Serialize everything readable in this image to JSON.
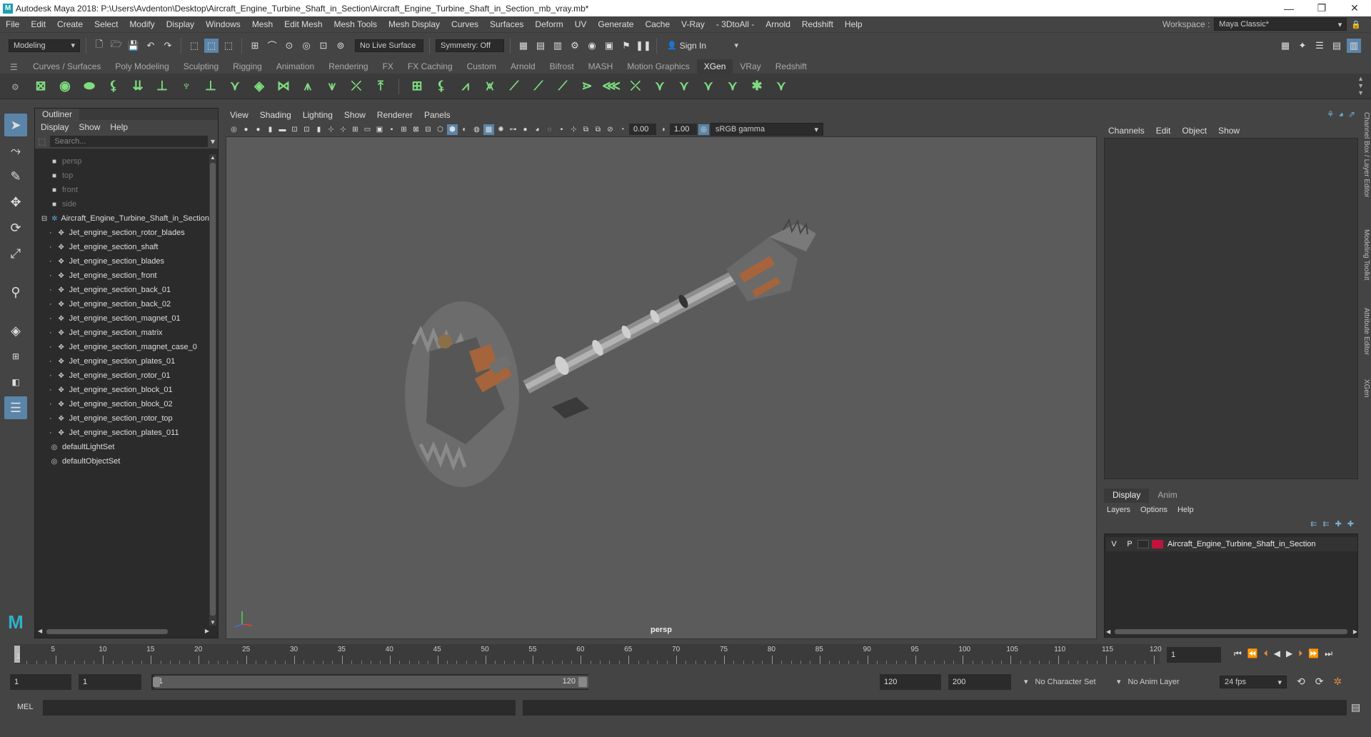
{
  "window": {
    "title": "Autodesk Maya 2018: P:\\Users\\Avdenton\\Desktop\\Aircraft_Engine_Turbine_Shaft_in_Section\\Aircraft_Engine_Turbine_Shaft_in_Section_mb_vray.mb*",
    "minimize": "—",
    "maximize": "❐",
    "close": "✕"
  },
  "menubar": {
    "items": [
      "File",
      "Edit",
      "Create",
      "Select",
      "Modify",
      "Display",
      "Windows",
      "Mesh",
      "Edit Mesh",
      "Mesh Tools",
      "Mesh Display",
      "Curves",
      "Surfaces",
      "Deform",
      "UV",
      "Generate",
      "Cache",
      "V-Ray",
      "- 3DtoAll -",
      "Arnold",
      "Redshift",
      "Help"
    ],
    "workspace_label": "Workspace :",
    "workspace_value": "Maya Classic*"
  },
  "statusline": {
    "mode": "Modeling",
    "live_surface": "No Live Surface",
    "symmetry": "Symmetry: Off",
    "sign_in": "Sign In"
  },
  "shelf": {
    "tabs": [
      "Curves / Surfaces",
      "Poly Modeling",
      "Sculpting",
      "Rigging",
      "Animation",
      "Rendering",
      "FX",
      "FX Caching",
      "Custom",
      "Arnold",
      "Bifrost",
      "MASH",
      "Motion Graphics",
      "XGen",
      "VRay",
      "Redshift"
    ],
    "active_tab": "XGen"
  },
  "outliner": {
    "title": "Outliner",
    "menu": [
      "Display",
      "Show",
      "Help"
    ],
    "search_placeholder": "Search...",
    "cameras": [
      "persp",
      "top",
      "front",
      "side"
    ],
    "root": "Aircraft_Engine_Turbine_Shaft_in_Section",
    "children": [
      "Jet_engine_section_rotor_blades",
      "Jet_engine_section_shaft",
      "Jet_engine_section_blades",
      "Jet_engine_section_front",
      "Jet_engine_section_back_01",
      "Jet_engine_section_back_02",
      "Jet_engine_section_magnet_01",
      "Jet_engine_section_matrix",
      "Jet_engine_section_magnet_case_0",
      "Jet_engine_section_plates_01",
      "Jet_engine_section_rotor_01",
      "Jet_engine_section_block_01",
      "Jet_engine_section_block_02",
      "Jet_engine_section_rotor_top",
      "Jet_engine_section_plates_011"
    ],
    "sets": [
      "defaultLightSet",
      "defaultObjectSet"
    ]
  },
  "viewport": {
    "menu": [
      "View",
      "Shading",
      "Lighting",
      "Show",
      "Renderer",
      "Panels"
    ],
    "exposure": "0.00",
    "gamma": "1.00",
    "color_space": "sRGB gamma",
    "camera_label": "persp"
  },
  "channelbox": {
    "menu": [
      "Channels",
      "Edit",
      "Object",
      "Show"
    ]
  },
  "layereditor": {
    "tabs": [
      "Display",
      "Anim"
    ],
    "menu": [
      "Layers",
      "Options",
      "Help"
    ],
    "layer": {
      "v": "V",
      "p": "P",
      "name": "Aircraft_Engine_Turbine_Shaft_in_Section",
      "color": "#c0143c"
    }
  },
  "side_tabs": [
    "Channel Box / Layer Editor",
    "Modeling Toolkit",
    "Attribute Editor",
    "XGen"
  ],
  "timeline": {
    "ticks": [
      5,
      10,
      15,
      20,
      25,
      30,
      35,
      40,
      45,
      50,
      55,
      60,
      65,
      70,
      75,
      80,
      85,
      90,
      95,
      100,
      105,
      110,
      115,
      120
    ],
    "start_marker": "1",
    "current_frame": "1"
  },
  "range": {
    "start": "1",
    "anim_start": "1",
    "range_start": "1",
    "range_end": "120",
    "anim_end": "120",
    "max_end": "200",
    "character_set": "No Character Set",
    "anim_layer": "No Anim Layer",
    "fps": "24 fps"
  },
  "commandline": {
    "label": "MEL"
  },
  "colors": {
    "accent": "#5b85a8",
    "shelf_icon": "#7fdc7f",
    "viewport_bg": "#5b5b5b"
  }
}
